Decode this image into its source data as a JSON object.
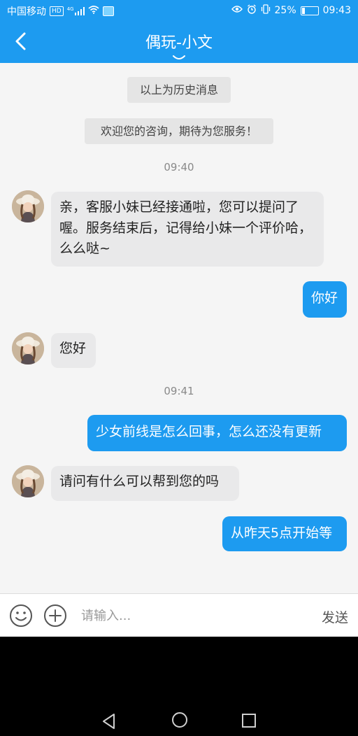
{
  "status_bar": {
    "carrier": "中国移动",
    "hd_badge": "HD",
    "network_type": "4G",
    "battery_percent": "25%",
    "battery_level": 0.25,
    "time": "09:43",
    "icons": [
      "hd-icon",
      "signal-icon",
      "wifi-icon",
      "app-notification-icon",
      "eye-icon",
      "alarm-icon",
      "vibrate-icon",
      "battery-icon"
    ]
  },
  "header": {
    "title": "偶玩-小文",
    "accent_color": "#1d9bf0"
  },
  "chat": {
    "history_notice": "以上为历史消息",
    "welcome_notice": "欢迎您的咨询，期待为您服务！",
    "time_1": "09:40",
    "time_2": "09:41",
    "messages": [
      {
        "from": "agent",
        "text": "亲，客服小妹已经接通啦，您可以提问了喔。服务结束后，记得给小妹一个评价哈，么么哒~"
      },
      {
        "from": "user",
        "text": "你好"
      },
      {
        "from": "agent",
        "text": "您好"
      },
      {
        "from": "user",
        "text": "少女前线是怎么回事，怎么还没有更新"
      },
      {
        "from": "agent",
        "text": "请问有什么可以帮到您的吗"
      },
      {
        "from": "user",
        "text": "从昨天5点开始等"
      }
    ]
  },
  "input_bar": {
    "placeholder": "请输入...",
    "value": "",
    "send_label": "发送"
  }
}
